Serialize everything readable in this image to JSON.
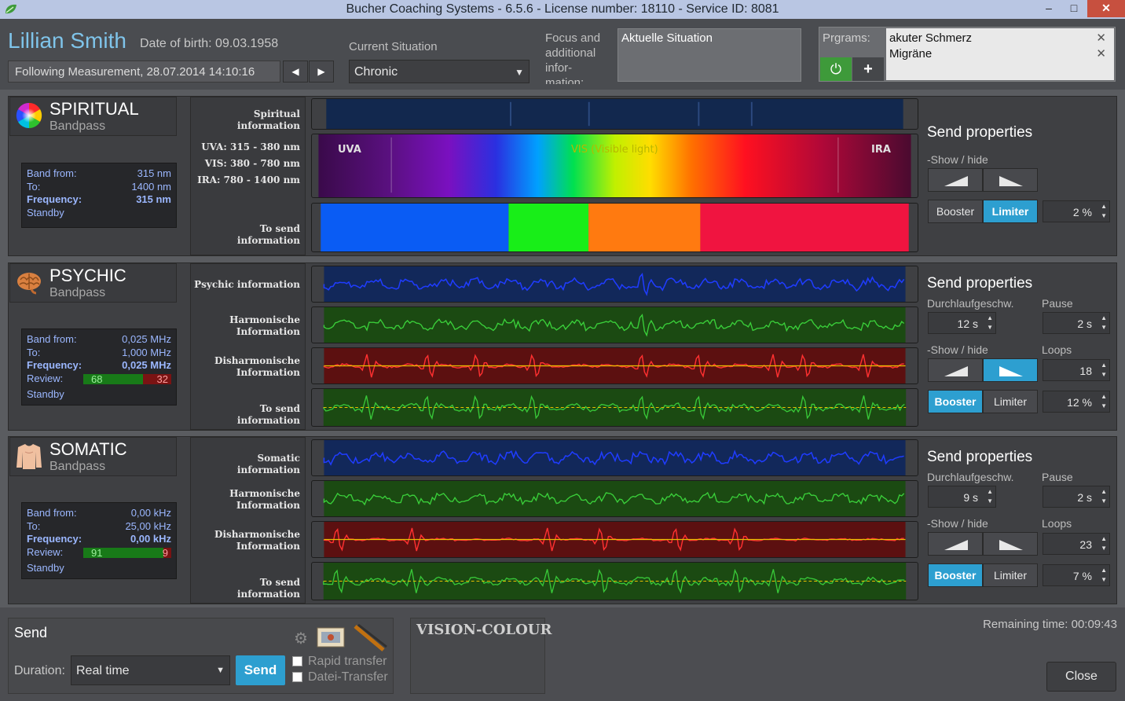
{
  "window": {
    "title": "Bucher Coaching Systems - 6.5.6 - License number: 18110 - Service ID: 8081",
    "minimize": "–",
    "maximize": "□",
    "close": "✕"
  },
  "patient": {
    "name": "Lillian Smith",
    "dob": "Date of birth: 09.03.1958",
    "measurement": "Following Measurement, 28.07.2014 14:10:16",
    "prev": "◀",
    "next": "▶"
  },
  "current_situation": {
    "label": "Current Situation",
    "value": "Chronic"
  },
  "focus": {
    "label": "Focus and additional infor-mation:",
    "text": "Aktuelle Situation"
  },
  "programs": {
    "label": "Prgrams:",
    "items": [
      "akuter Schmerz",
      "Migräne"
    ]
  },
  "sections": {
    "spiritual": {
      "title": "SPIRITUAL",
      "subtitle": "Bandpass",
      "band_from_label": "Band from:",
      "band_from": "315 nm",
      "to_label": "To:",
      "to": "1400 nm",
      "freq_label": "Frequency:",
      "freq": "315 nm",
      "status": "Standby",
      "labels": [
        "Spiritual information",
        "UVA: 315 - 380 nm",
        "VIS: 380 - 780 nm",
        "IRA: 780 - 1400 nm",
        "To send information"
      ],
      "spectrum": {
        "uva": "UVA",
        "vis": "VIS (Visible light)",
        "ira": "IRA"
      },
      "props": {
        "title": "Send properties",
        "show_hide": "-Show / hide",
        "booster": "Booster",
        "limiter": "Limiter",
        "percent": "2 %",
        "limiter_on": true
      }
    },
    "psychic": {
      "title": "PSYCHIC",
      "subtitle": "Bandpass",
      "band_from_label": "Band from:",
      "band_from": "0,025 MHz",
      "to_label": "To:",
      "to": "1,000 MHz",
      "freq_label": "Frequency:",
      "freq": "0,025 MHz",
      "review_label": "Review:",
      "review_good": "68",
      "review_bad": "32",
      "review_fraction": 0.68,
      "status": "Standby",
      "labels": [
        "Psychic information",
        "Harmonische Information",
        "Disharmonische Information",
        "To send information"
      ],
      "props": {
        "title": "Send properties",
        "speed_label": "Durchlaufgeschw.",
        "speed": "12 s",
        "pause_label": "Pause",
        "pause": "2 s",
        "show_hide": "-Show / hide",
        "loops_label": "Loops",
        "loops": "18",
        "booster": "Booster",
        "limiter": "Limiter",
        "percent": "12 %"
      }
    },
    "somatic": {
      "title": "SOMATIC",
      "subtitle": "Bandpass",
      "band_from_label": "Band from:",
      "band_from": "0,00 kHz",
      "to_label": "To:",
      "to": "25,00 kHz",
      "freq_label": "Frequency:",
      "freq": "0,00 kHz",
      "review_label": "Review:",
      "review_good": "91",
      "review_bad": "9",
      "review_fraction": 0.91,
      "status": "Standby",
      "labels": [
        "Somatic information",
        "Harmonische Information",
        "Disharmonische Information",
        "To send information"
      ],
      "props": {
        "title": "Send properties",
        "speed_label": "Durchlaufgeschw.",
        "speed": "9 s",
        "pause_label": "Pause",
        "pause": "2 s",
        "show_hide": "-Show / hide",
        "loops_label": "Loops",
        "loops": "23",
        "booster": "Booster",
        "limiter": "Limiter",
        "percent": "7 %"
      }
    }
  },
  "footer": {
    "send_title": "Send",
    "duration_label": "Duration:",
    "duration_value": "Real time",
    "send_button": "Send",
    "rapid_transfer": "Rapid transfer",
    "datei_transfer": "Datei-Transfer",
    "vision_colour": "VISION-COLOUR",
    "remaining": "Remaining time: 00:09:43",
    "close": "Close"
  },
  "colors": {
    "accent": "#2d9fd0",
    "power_green": "#3e9a3a",
    "name_blue": "#7fc4ea"
  }
}
